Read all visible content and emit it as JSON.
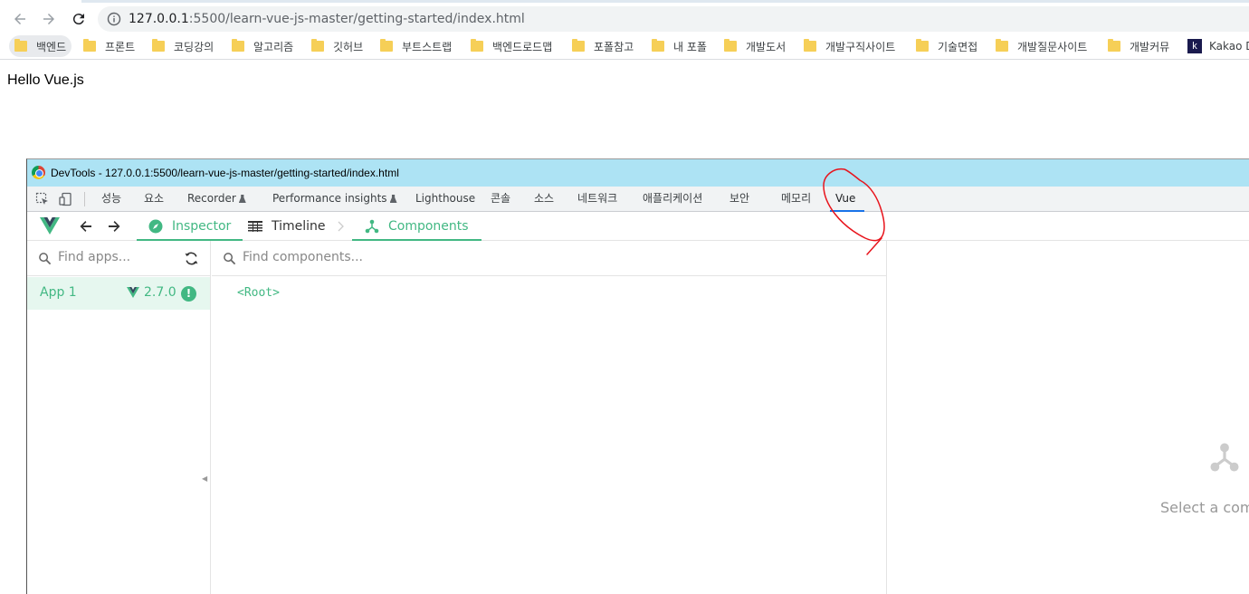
{
  "browser": {
    "url_host": "127.0.0.1",
    "url_path": ":5500/learn-vue-js-master/getting-started/index.html"
  },
  "bookmarks": [
    {
      "label": "백엔드",
      "icon": "folder-icon"
    },
    {
      "label": "프론트",
      "icon": "folder-icon"
    },
    {
      "label": "코딩강의",
      "icon": "folder-icon"
    },
    {
      "label": "알고리즘",
      "icon": "folder-icon"
    },
    {
      "label": "깃허브",
      "icon": "folder-icon"
    },
    {
      "label": "부트스트랩",
      "icon": "folder-icon"
    },
    {
      "label": "백엔드로드맵",
      "icon": "folder-icon"
    },
    {
      "label": "포폴참고",
      "icon": "folder-icon"
    },
    {
      "label": "내 포폴",
      "icon": "folder-icon"
    },
    {
      "label": "개발도서",
      "icon": "folder-icon"
    },
    {
      "label": "개발구직사이트",
      "icon": "folder-icon"
    },
    {
      "label": "기술면접",
      "icon": "folder-icon"
    },
    {
      "label": "개발질문사이트",
      "icon": "folder-icon"
    },
    {
      "label": "개발커뮤",
      "icon": "folder-icon"
    },
    {
      "label": "Kakao D",
      "icon": "kakao-icon",
      "icon_letter": "k"
    }
  ],
  "page": {
    "text": "Hello Vue.js"
  },
  "devtools": {
    "window_title": "DevTools - 127.0.0.1:5500/learn-vue-js-master/getting-started/index.html",
    "tabs": [
      {
        "label": "성능"
      },
      {
        "label": "요소"
      },
      {
        "label": "Recorder"
      },
      {
        "label": "Performance insights"
      },
      {
        "label": "Lighthouse"
      },
      {
        "label": "콘솔"
      },
      {
        "label": "소스"
      },
      {
        "label": "네트워크"
      },
      {
        "label": "애플리케이션"
      },
      {
        "label": "보안"
      },
      {
        "label": "메모리"
      },
      {
        "label": "Vue"
      }
    ],
    "active_tab": "Vue"
  },
  "vue": {
    "tabs": {
      "inspector": "Inspector",
      "timeline": "Timeline",
      "components": "Components"
    },
    "find_apps_placeholder": "Find apps...",
    "find_components_placeholder": "Find components...",
    "app": {
      "name": "App 1",
      "version": "2.7.0",
      "warning": "!"
    },
    "root_node": "<Root>",
    "empty_message": "Select a comp"
  },
  "colors": {
    "vue_green": "#42b883",
    "devtools_title_bg": "#ade3f4",
    "annotation": "#e8141c"
  }
}
